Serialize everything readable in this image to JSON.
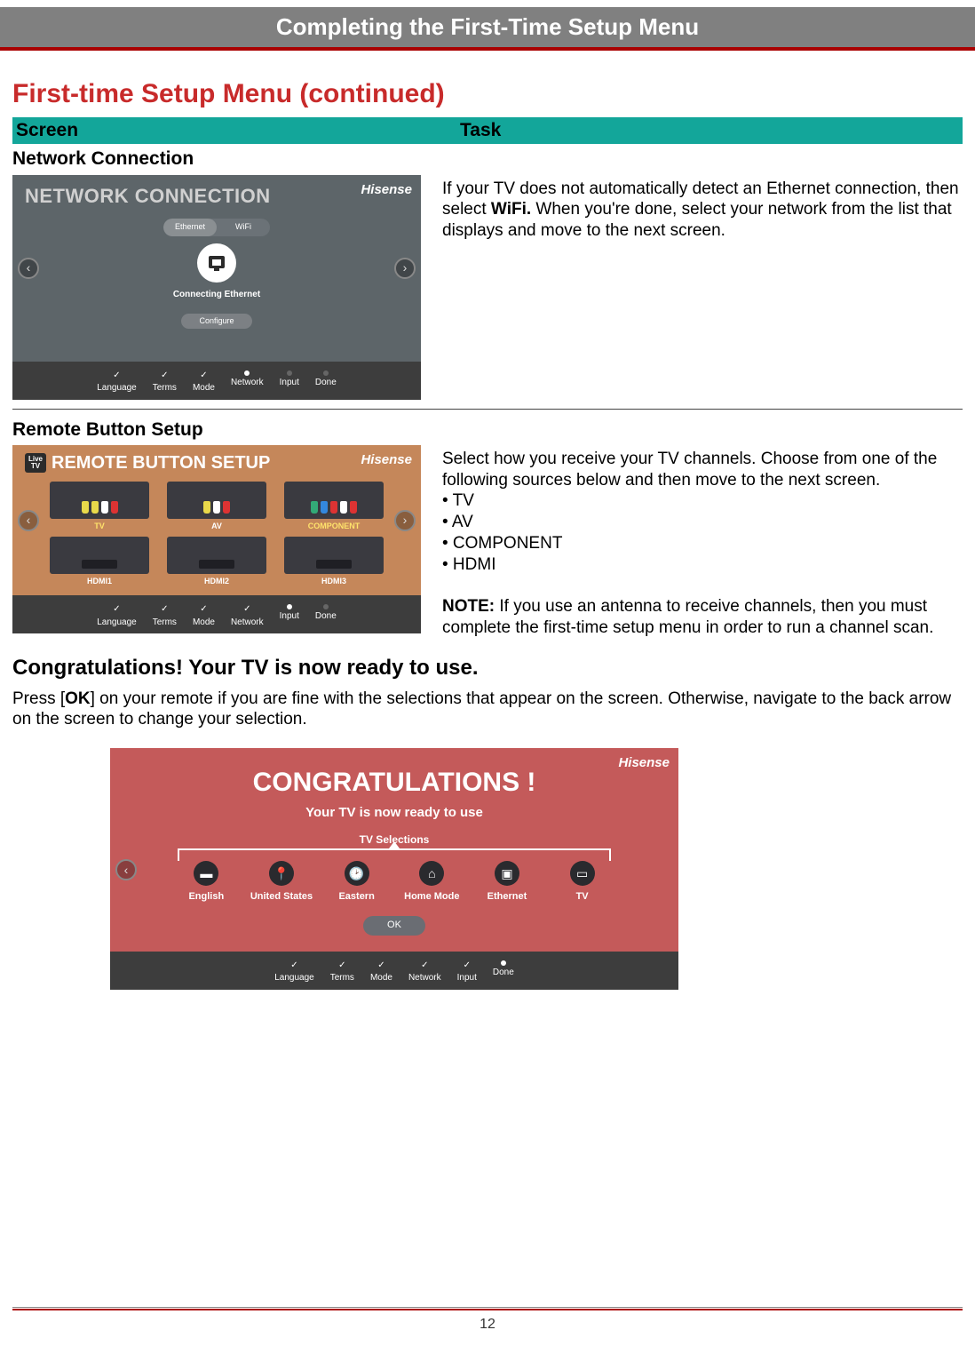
{
  "header": {
    "title": "Completing the First-Time Setup Menu"
  },
  "section_title": "First-time Setup Menu (continued)",
  "columns": {
    "screen": "Screen",
    "task": "Task"
  },
  "row1": {
    "label": "Network Connection",
    "task_a": "If your TV does not automatically detect an Ethernet connection, then select ",
    "task_bold": "WiFi.",
    "task_b": " When you're done, select your network from the list that displays and move to the next screen."
  },
  "ns": {
    "title": "NETWORK CONNECTION",
    "brand": "Hisense",
    "toggle": {
      "a": "Ethernet",
      "b": "WiFi"
    },
    "connecting": "Connecting Ethernet",
    "configure": "Configure",
    "steps": [
      "Language",
      "Terms",
      "Mode",
      "Network",
      "Input",
      "Done"
    ]
  },
  "row2": {
    "label": "Remote Button Setup",
    "task_intro": "Select how you receive your TV channels. Choose from one of the following sources below and then move to the next screen.",
    "b1": "• TV",
    "b2": "• AV",
    "b3": "• COMPONENT",
    "b4": "• HDMI",
    "note_label": "NOTE:",
    "note_text": " If you use an antenna to receive channels, then you must complete the first-time setup menu in order to run a channel scan."
  },
  "rb": {
    "live": {
      "l1": "Live",
      "l2": "TV"
    },
    "title": "REMOTE BUTTON SETUP",
    "brand": "Hisense",
    "inputs": [
      "TV",
      "AV",
      "COMPONENT",
      "HDMI1",
      "HDMI2",
      "HDMI3"
    ],
    "steps": [
      "Language",
      "Terms",
      "Mode",
      "Network",
      "Input",
      "Done"
    ]
  },
  "congrats_head": "Congratulations! Your TV is now ready to use.",
  "congrats_text_a": "Press [",
  "congrats_text_b": "OK",
  "congrats_text_c": "] on your remote if you are fine with the selections that appear on the screen. Otherwise, navigate to the back arrow on the screen to change your selection.",
  "cg": {
    "brand": "Hisense",
    "title": "CONGRATULATIONS !",
    "sub": "Your TV is now ready to use",
    "sel": "TV Selections",
    "items": [
      "English",
      "United States",
      "Eastern",
      "Home Mode",
      "Ethernet",
      "TV"
    ],
    "ok": "OK",
    "steps": [
      "Language",
      "Terms",
      "Mode",
      "Network",
      "Input",
      "Done"
    ]
  },
  "page": "12"
}
